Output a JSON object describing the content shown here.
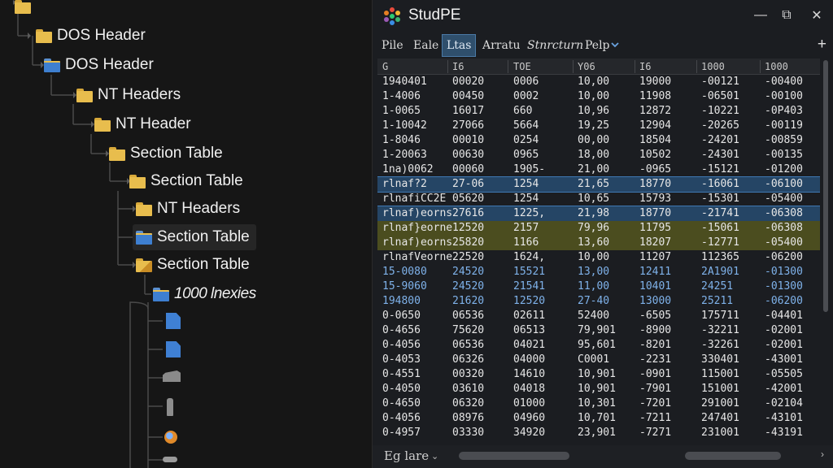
{
  "tree": {
    "nodes": [
      {
        "label": "DOS Header"
      },
      {
        "label": "DOS Header"
      },
      {
        "label": "NT Headers"
      },
      {
        "label": "NT Header"
      },
      {
        "label": "Section Table"
      },
      {
        "label": "Section Table"
      },
      {
        "label": "NT Headers"
      },
      {
        "label": "Section Table"
      },
      {
        "label": "Section Table"
      },
      {
        "label": "1000 lnexies"
      }
    ],
    "icons": [
      "folder-icon",
      "file-icon",
      "gear-icon",
      "orb-icon"
    ]
  },
  "window": {
    "title": "StudPE",
    "minimize": "—",
    "restore": "⧉",
    "close": "✕"
  },
  "menu": {
    "items": [
      "Pile",
      "Eale",
      "Ltas",
      "Arratu",
      "Stnrcturn",
      "Pelp"
    ],
    "active_index": 2,
    "add": "+"
  },
  "table": {
    "columns": [
      "G",
      "I6",
      "TOE",
      "Y06",
      "I6",
      "1000",
      "1000"
    ],
    "rows": [
      {
        "cells": [
          "1940401",
          "00020",
          "0006",
          "10,00",
          "19000",
          "-00121",
          "-00400"
        ],
        "style": ""
      },
      {
        "cells": [
          "1-4006",
          "00450",
          "0002",
          "10,00",
          "11908",
          "-06501",
          "-00100"
        ],
        "style": ""
      },
      {
        "cells": [
          "1-0065",
          "16017",
          "660",
          "10,96",
          "12872",
          "-10221",
          "-0P403"
        ],
        "style": ""
      },
      {
        "cells": [
          "1-10042",
          "27066",
          "5664",
          "19,25",
          "12904",
          "-20265",
          "-00119"
        ],
        "style": ""
      },
      {
        "cells": [
          "1-8046",
          "00010",
          "0254",
          "00,00",
          "18504",
          "-24201",
          "-00859"
        ],
        "style": ""
      },
      {
        "cells": [
          "1-20063",
          "00630",
          "0965",
          "18,00",
          "10502",
          "-24301",
          "-00135"
        ],
        "style": ""
      },
      {
        "cells": [
          "1na)0062",
          "00060",
          "1905-",
          "21,00",
          "-0965",
          "-15121",
          "-01200"
        ],
        "style": ""
      },
      {
        "cells": [
          "rlnaf?2",
          "27-06",
          "1254",
          "21,65",
          "18770",
          "-16061",
          "-06100"
        ],
        "style": "hl-blue"
      },
      {
        "cells": [
          "rlnafiCC2E",
          "05620",
          "1254",
          "10,65",
          "15793",
          "-15301",
          "-05400"
        ],
        "style": ""
      },
      {
        "cells": [
          "rlnaf)eorns",
          "27616",
          "1225,",
          "21,98",
          "18770",
          "-21741",
          "-06308"
        ],
        "style": "hl-blue"
      },
      {
        "cells": [
          "rlnaf}eorne",
          "12520",
          "2157",
          "79,96",
          "11795",
          "-15061",
          "-06308"
        ],
        "style": "hl-green"
      },
      {
        "cells": [
          "rlnaf)eorns",
          "25820",
          "1166",
          "13,60",
          "18207",
          "-12771",
          "-05400"
        ],
        "style": "hl-green"
      },
      {
        "cells": [
          "rlnafVeorne",
          "22520",
          "1624,",
          "10,00",
          "11207",
          "112365",
          "-06200"
        ],
        "style": ""
      },
      {
        "cells": [
          "15-0080",
          "24520",
          "15521",
          "13,00",
          "12411",
          "2A1901",
          "-01300"
        ],
        "style": "blue-text"
      },
      {
        "cells": [
          "15-9060",
          "24520",
          "21541",
          "11,00",
          "10401",
          "24251",
          "-01300"
        ],
        "style": "blue-text"
      },
      {
        "cells": [
          "194800",
          "21620",
          "12520",
          "27-40",
          "13000",
          "25211",
          "-06200"
        ],
        "style": "blue-text"
      },
      {
        "cells": [
          "0-0650",
          "06536",
          "02611",
          "52400",
          "-6505",
          "175711",
          "-04401"
        ],
        "style": ""
      },
      {
        "cells": [
          "0-4656",
          "75620",
          "06513",
          "79,901",
          "-8900",
          "-32211",
          "-02001"
        ],
        "style": ""
      },
      {
        "cells": [
          "0-4056",
          "06536",
          "04021",
          "95,601",
          "-8201",
          "-32261",
          "-02001"
        ],
        "style": ""
      },
      {
        "cells": [
          "0-4053",
          "06326",
          "04000",
          "C0001",
          "-2231",
          "330401",
          "-43001"
        ],
        "style": ""
      },
      {
        "cells": [
          "0-4551",
          "00320",
          "14610",
          "10,901",
          "-0901",
          "115001",
          "-05505"
        ],
        "style": ""
      },
      {
        "cells": [
          "0-4050",
          "03610",
          "04018",
          "10,901",
          "-7901",
          "151001",
          "-42001"
        ],
        "style": ""
      },
      {
        "cells": [
          "0-4650",
          "06320",
          "01000",
          "10,301",
          "-7201",
          "291001",
          "-02104"
        ],
        "style": ""
      },
      {
        "cells": [
          "0-4056",
          "08976",
          "04960",
          "10,701",
          "-7211",
          "247401",
          "-43101"
        ],
        "style": ""
      },
      {
        "cells": [
          "0-4957",
          "03330",
          "34920",
          "23,901",
          "-7271",
          "231001",
          "-43191"
        ],
        "style": ""
      }
    ]
  },
  "status": {
    "label": "Eg lare",
    "dropdown": "⌄",
    "arrow": "›"
  },
  "colors": {
    "accent": "#2f4f6c",
    "row_highlight_blue": "#254565",
    "row_highlight_green": "#4b4d1f",
    "folder": "#e8bd4d"
  }
}
